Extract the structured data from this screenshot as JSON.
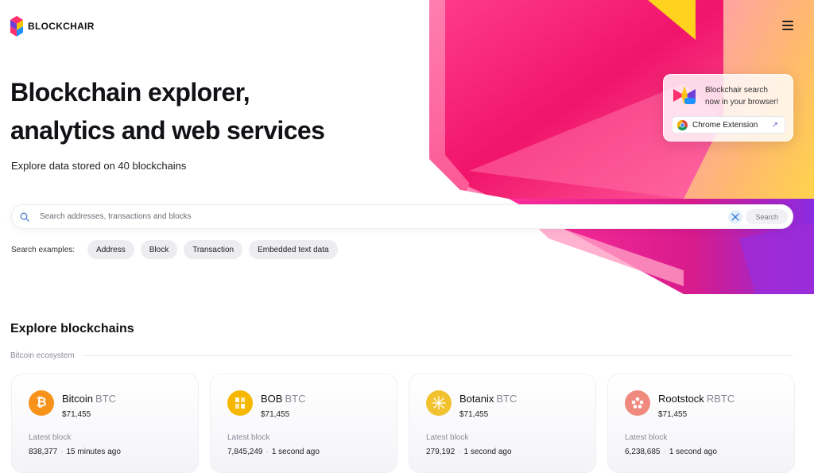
{
  "brand": {
    "name": "BLOCKCHAIR"
  },
  "hero": {
    "title_line1": "Blockchain explorer,",
    "title_line2": "analytics and web services",
    "subtitle": "Explore data stored on 40 blockchains"
  },
  "extension_promo": {
    "text_line1": "Blockchair search",
    "text_line2": "now in your browser!",
    "button_label": "Chrome Extension",
    "button_arrow": "↗"
  },
  "search": {
    "placeholder": "Search addresses, transactions and blocks",
    "button_label": "Search"
  },
  "examples": {
    "label": "Search examples:",
    "chips": [
      "Address",
      "Block",
      "Transaction",
      "Embedded text data"
    ]
  },
  "explore": {
    "title": "Explore blockchains",
    "ecosystem_label": "Bitcoin ecosystem",
    "latest_block_label": "Latest block",
    "chains": [
      {
        "name": "Bitcoin",
        "ticker": "BTC",
        "price": "$71,455",
        "block": "838,377",
        "age": "15 minutes ago",
        "icon": "bitcoin-icon",
        "color": "#f7931a"
      },
      {
        "name": "BOB",
        "ticker": "BTC",
        "price": "$71,455",
        "block": "7,845,249",
        "age": "1 second ago",
        "icon": "bob-icon",
        "color": "#f5b700"
      },
      {
        "name": "Botanix",
        "ticker": "BTC",
        "price": "$71,455",
        "block": "279,192",
        "age": "1 second ago",
        "icon": "botanix-icon",
        "color": "#f2c12e"
      },
      {
        "name": "Rootstock",
        "ticker": "RBTC",
        "price": "$71,455",
        "block": "6,238,685",
        "age": "1 second ago",
        "icon": "rootstock-icon",
        "color": "#f08a7e"
      }
    ]
  },
  "colors": {
    "accent": "#6b6bd8",
    "hero_magenta": "#e6007e",
    "hero_pink": "#ff4f86",
    "hero_yellow": "#ffd21e",
    "hero_purple": "#8a2be2"
  }
}
